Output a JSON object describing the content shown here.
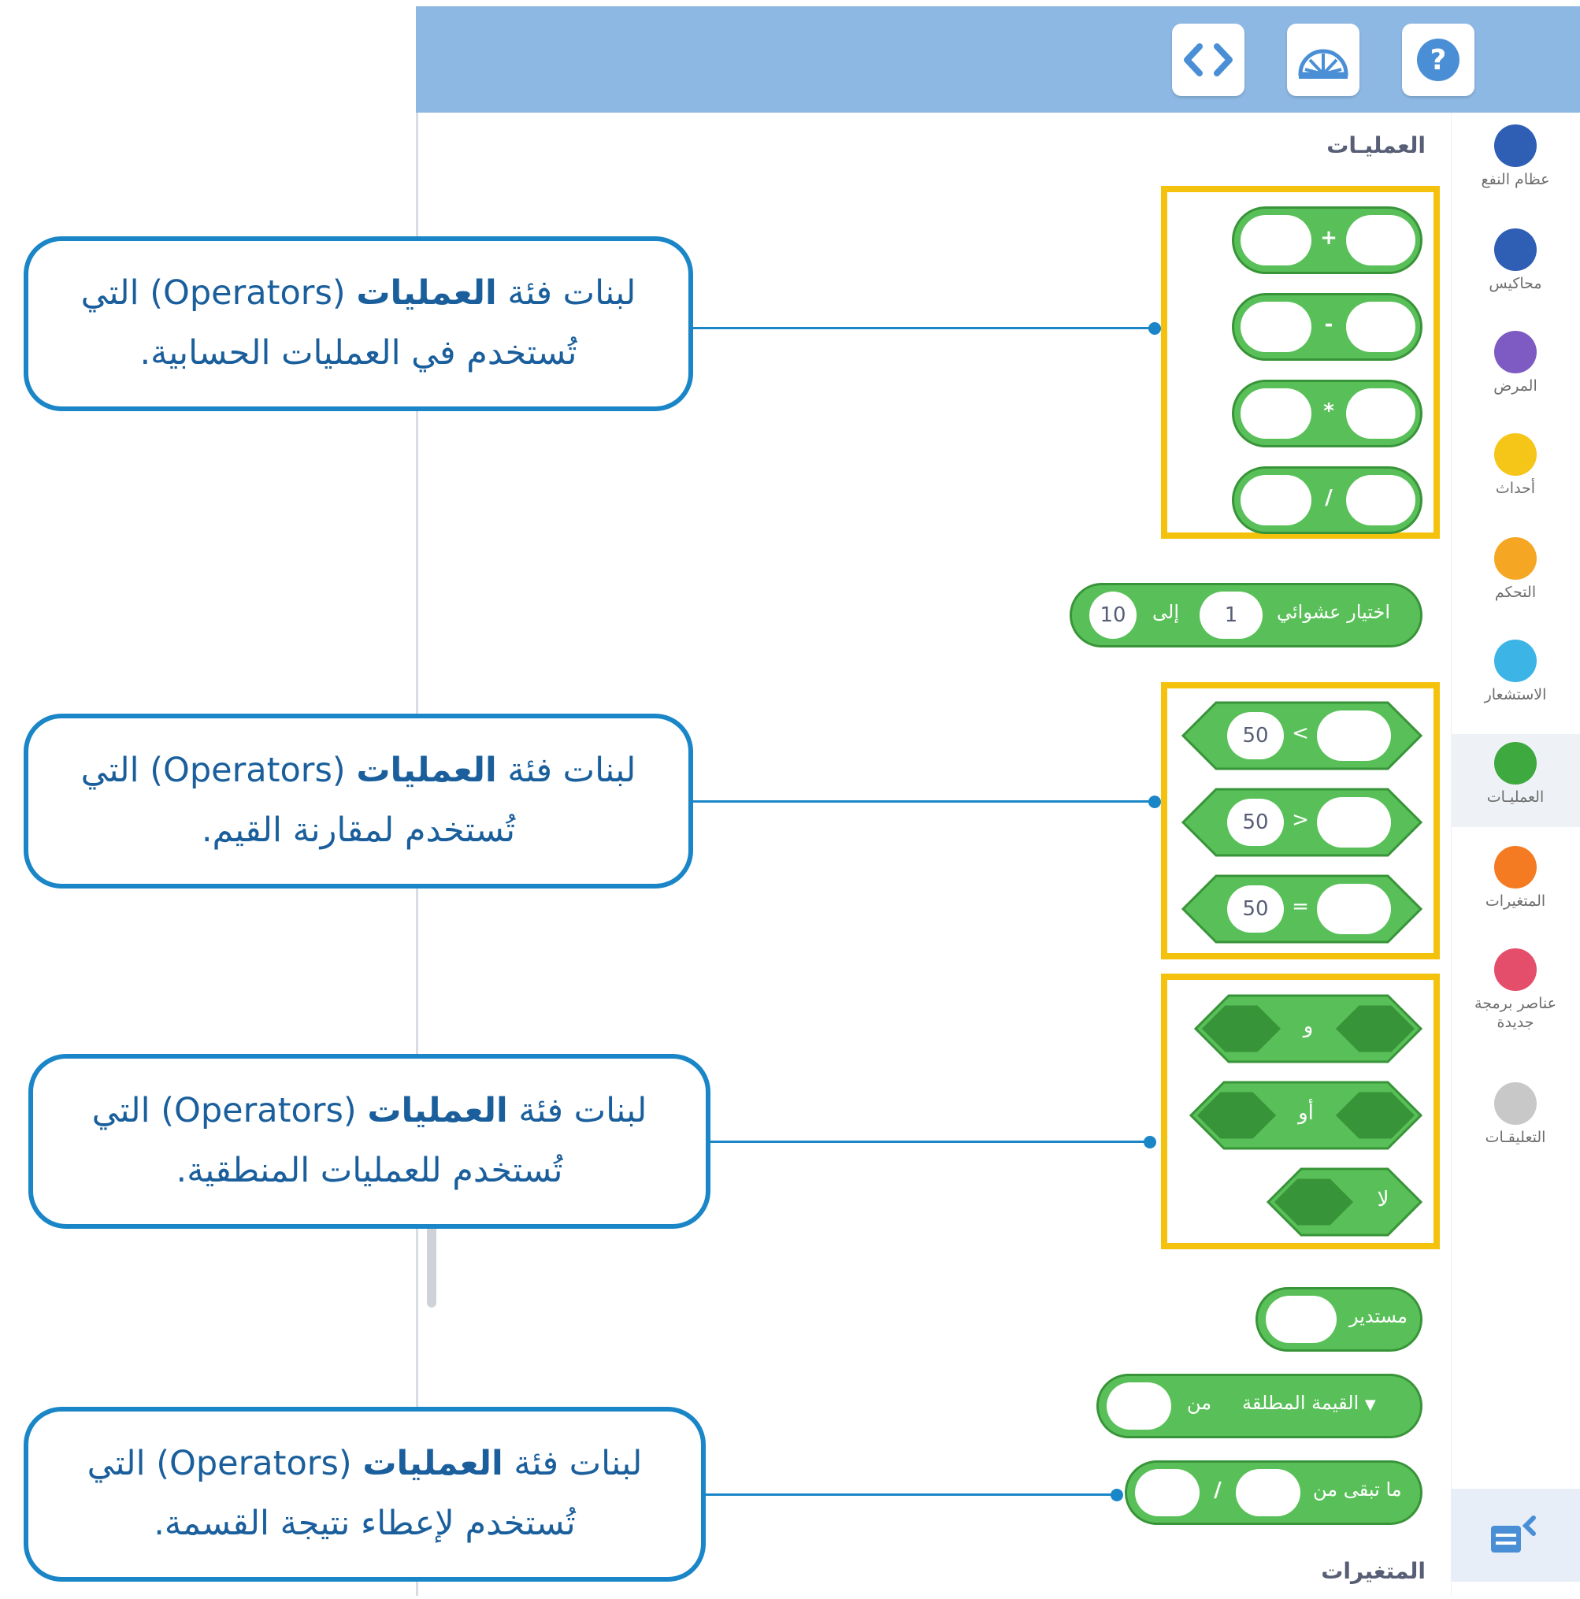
{
  "toolbar": {
    "code_icon": "code-brackets-icon",
    "dashboard_icon": "dashboard-gauge-icon",
    "help_icon": "help-question-icon"
  },
  "sidebar": {
    "categories": [
      {
        "label": "عظام النفع",
        "color": "#2e5fb5"
      },
      {
        "label": "محاكيس",
        "color": "#2e5fb5"
      },
      {
        "label": "المرض",
        "color": "#7e5bc2"
      },
      {
        "label": "أحداث",
        "color": "#f5c518"
      },
      {
        "label": "التحكم",
        "color": "#f5a623"
      },
      {
        "label": "الاستشعار",
        "color": "#3cb4e5"
      },
      {
        "label": "العمليـات",
        "color": "#3ea93e"
      },
      {
        "label": "المتغيرات",
        "color": "#f47b22"
      },
      {
        "label": "عناصر برمجة جديدة",
        "color": "#e44e6b"
      },
      {
        "label": "التعليقـات",
        "color": "#c8c8c8"
      }
    ],
    "active_index": 6
  },
  "palette": {
    "section_title": "العمليـات",
    "arith_ops": [
      "+",
      "-",
      "*",
      "/"
    ],
    "random_block": {
      "label": "اختيار عشوائي",
      "from_value": "1",
      "to_label": "إلى",
      "to_value": "10"
    },
    "compare_ops": [
      "<",
      ">",
      "="
    ],
    "compare_value": "50",
    "logic_ops": [
      "و",
      "أو",
      "لا"
    ],
    "round_label": "مستدير",
    "math_block": {
      "dropdown": "القيمة المطلقة",
      "of_label": "من"
    },
    "mod_block": {
      "label": "ما تبقى من",
      "op": "/"
    },
    "next_section_title": "المتغيرات"
  },
  "callouts": [
    {
      "pre": "لبنات فئة ",
      "bold": "العمليات",
      "post": " (Operators) التي",
      "line2": "تُستخدم في العمليات الحسابية."
    },
    {
      "pre": "لبنات فئة ",
      "bold": "العمليات",
      "post": " (Operators) التي",
      "line2": "تُستخدم لمقارنة القيم."
    },
    {
      "pre": "لبنات فئة ",
      "bold": "العمليات",
      "post": " (Operators) التي",
      "line2": "تُستخدم للعمليات المنطقية."
    },
    {
      "pre": "لبنات فئة ",
      "bold": "العمليات",
      "post": " (Operators) التي",
      "line2": "تُستخدم لإعطاء نتيجة القسمة."
    }
  ],
  "colors": {
    "block_fill": "#59c059",
    "block_border": "#389438",
    "highlight": "#f4c20d",
    "callout_border": "#1a86c8",
    "topbar": "#8db8e3"
  }
}
